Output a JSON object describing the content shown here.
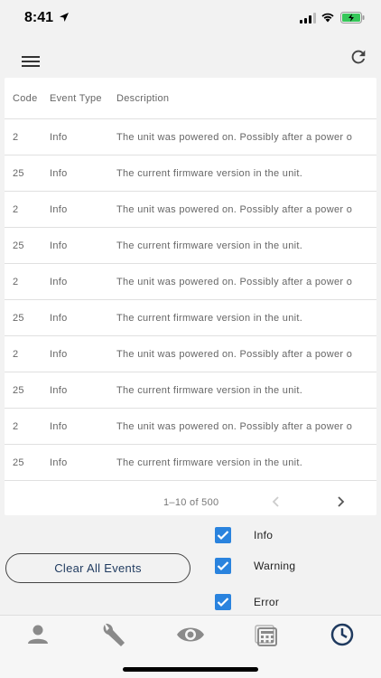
{
  "status_bar": {
    "time": "8:41"
  },
  "table": {
    "headers": {
      "code": "Code",
      "event_type": "Event Type",
      "description": "Description"
    },
    "rows": [
      {
        "code": "2",
        "type": "Info",
        "description": "The unit was powered on. Possibly after a power o"
      },
      {
        "code": "25",
        "type": "Info",
        "description": "The current firmware version in the unit."
      },
      {
        "code": "2",
        "type": "Info",
        "description": "The unit was powered on. Possibly after a power o"
      },
      {
        "code": "25",
        "type": "Info",
        "description": "The current firmware version in the unit."
      },
      {
        "code": "2",
        "type": "Info",
        "description": "The unit was powered on. Possibly after a power o"
      },
      {
        "code": "25",
        "type": "Info",
        "description": "The current firmware version in the unit."
      },
      {
        "code": "2",
        "type": "Info",
        "description": "The unit was powered on. Possibly after a power o"
      },
      {
        "code": "25",
        "type": "Info",
        "description": "The current firmware version in the unit."
      },
      {
        "code": "2",
        "type": "Info",
        "description": "The unit was powered on. Possibly after a power o"
      },
      {
        "code": "25",
        "type": "Info",
        "description": "The current firmware version in the unit."
      }
    ],
    "pagination": {
      "range": "1–10 of 500"
    }
  },
  "actions": {
    "clear_label": "Clear All Events"
  },
  "filters": [
    {
      "label": "Info",
      "checked": true
    },
    {
      "label": "Warning",
      "checked": true
    },
    {
      "label": "Error",
      "checked": true
    }
  ],
  "bottom_nav": {
    "items": [
      {
        "icon": "person-icon",
        "active": false
      },
      {
        "icon": "wrench-icon",
        "active": false
      },
      {
        "icon": "eye-icon",
        "active": false
      },
      {
        "icon": "calculator-icon",
        "active": false
      },
      {
        "icon": "clock-icon",
        "active": true
      }
    ]
  },
  "colors": {
    "accent": "#2a83de",
    "nav_active": "#1f3a5f",
    "nav_inactive": "#8a8a8a"
  }
}
